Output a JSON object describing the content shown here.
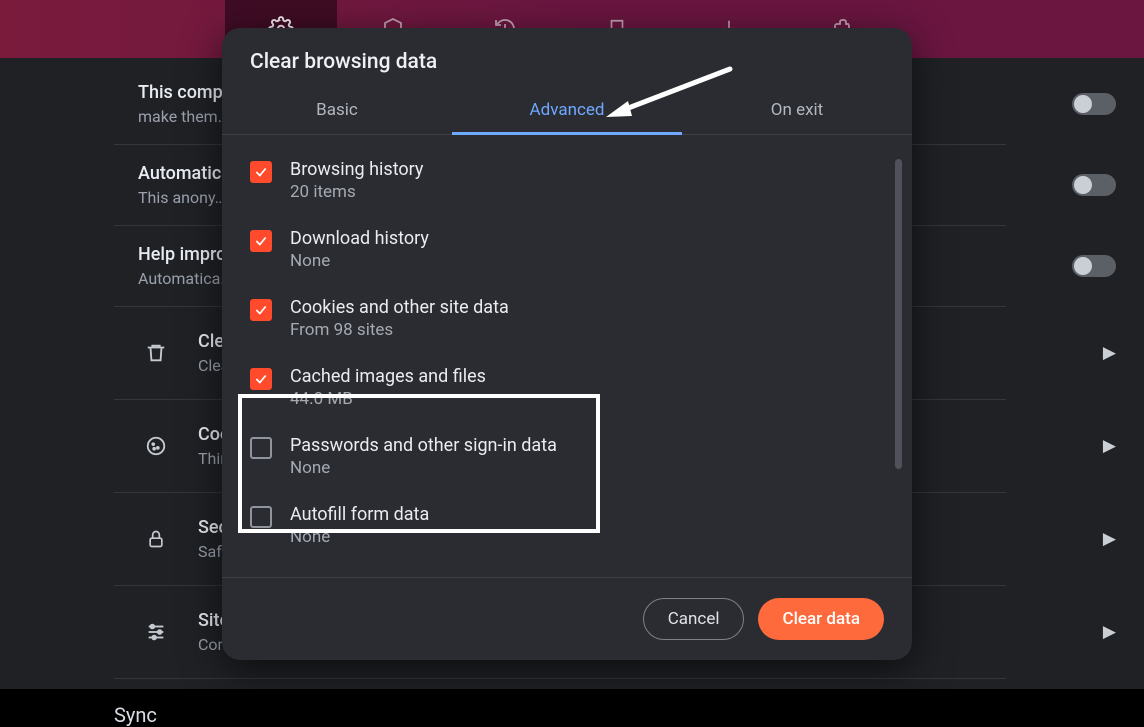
{
  "modal": {
    "title": "Clear browsing data",
    "tabs": {
      "basic": "Basic",
      "advanced": "Advanced",
      "onexit": "On exit"
    },
    "items": [
      {
        "checked": true,
        "label": "Browsing history",
        "sub": "20 items"
      },
      {
        "checked": true,
        "label": "Download history",
        "sub": "None"
      },
      {
        "checked": true,
        "label": "Cookies and other site data",
        "sub": "From 98 sites"
      },
      {
        "checked": true,
        "label": "Cached images and files",
        "sub": "44.0 MB"
      },
      {
        "checked": false,
        "label": "Passwords and other sign-in data",
        "sub": "None"
      },
      {
        "checked": false,
        "label": "Autofill form data",
        "sub": "None"
      }
    ],
    "cancel": "Cancel",
    "clear": "Clear data"
  },
  "bg": {
    "row0_title": "This compl…",
    "row0_sub": "make them…",
    "row1_title": "Automatica…",
    "row1_sub": "This anony…",
    "row2_title": "Help impro…",
    "row2_sub": "Automatica…",
    "sub_clear_title": "Clea…",
    "sub_clear_sub": "Clea…",
    "sub_cook_title": "Cook…",
    "sub_cook_sub": "Third…",
    "sub_secu_title": "Secu…",
    "sub_secu_sub": "Safe…",
    "sub_site_title": "Site …",
    "sub_site_sub": "Cont…",
    "sync": "Sync"
  }
}
